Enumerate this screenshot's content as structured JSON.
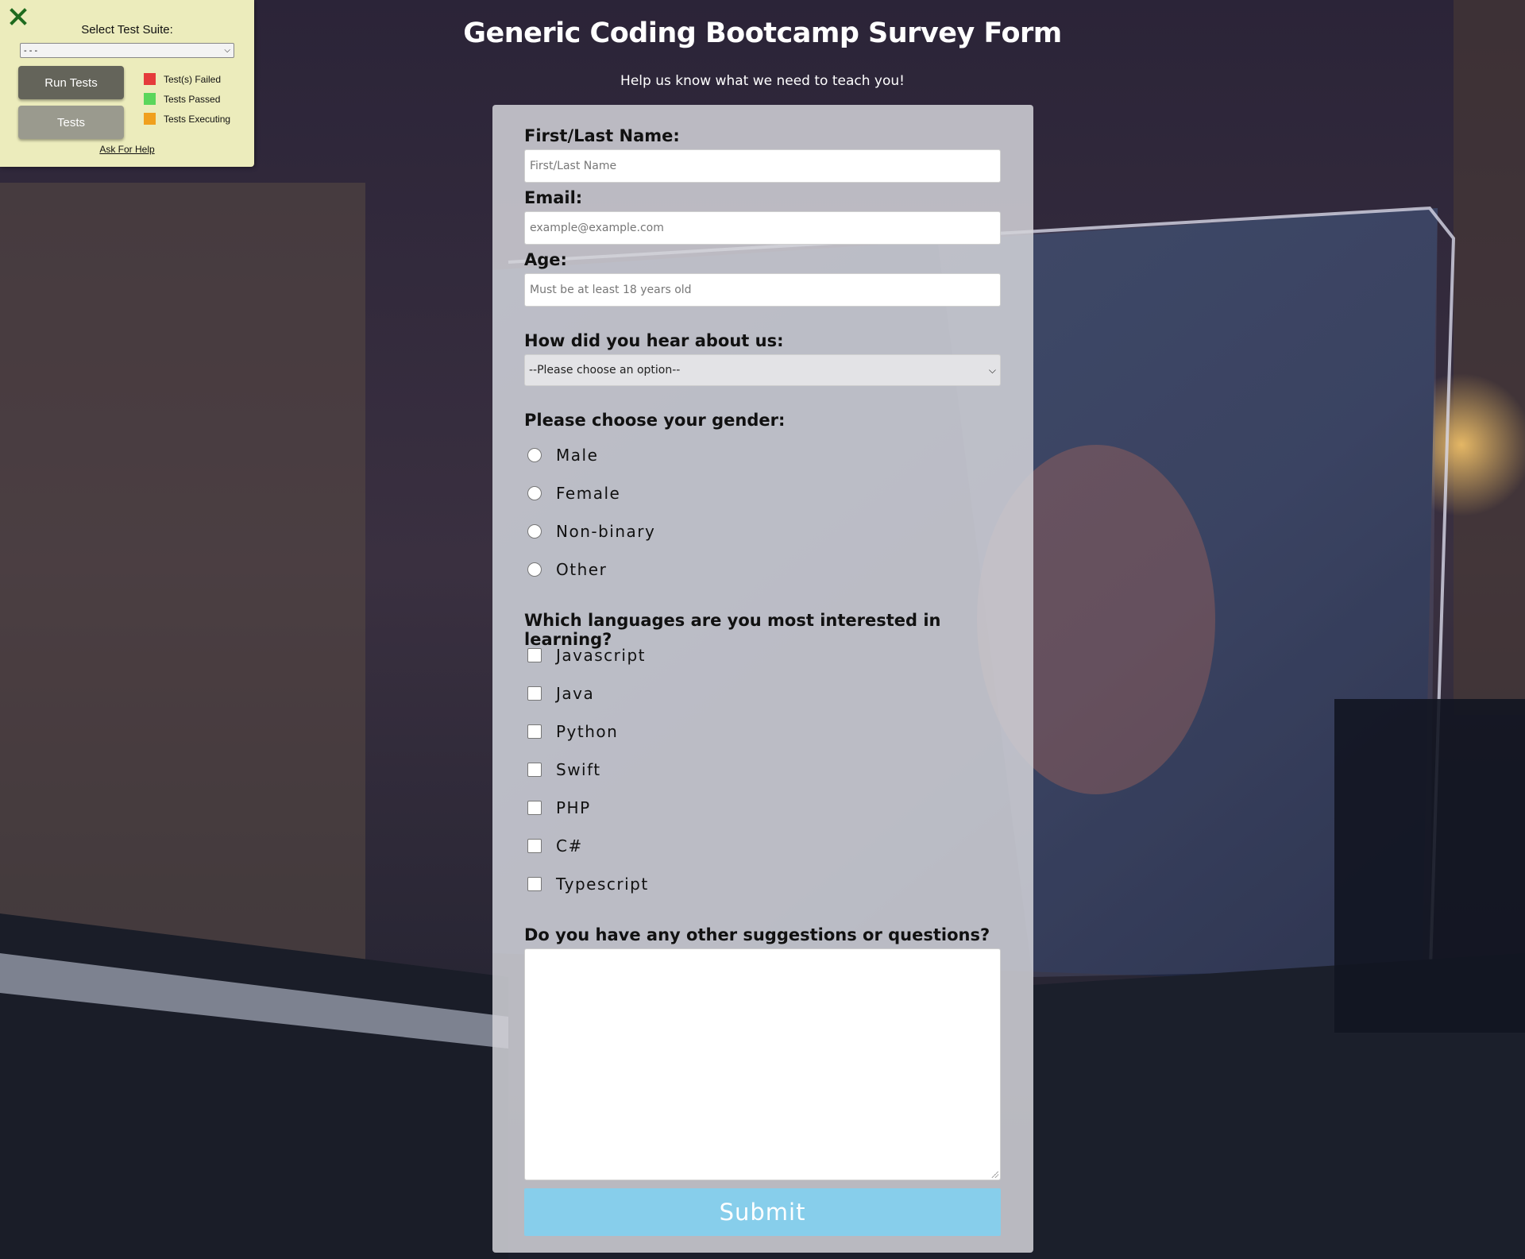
{
  "colors": {
    "submit_bg": "#87ceeb",
    "failed": "#e53b3b",
    "passed": "#5bd65b",
    "executing": "#f0a01e",
    "panel_bg": "#ececbc",
    "run_btn": "#64645a",
    "tests_btn": "#9a9a8e"
  },
  "test_panel": {
    "suite_label": "Select Test Suite:",
    "suite_value": "- - -",
    "run_button": "Run Tests",
    "tests_button": "Tests",
    "legend": [
      {
        "label": "Test(s) Failed",
        "color": "#e53b3b"
      },
      {
        "label": "Tests Passed",
        "color": "#5bd65b"
      },
      {
        "label": "Tests Executing",
        "color": "#f0a01e"
      }
    ],
    "help_link": "Ask For Help",
    "close_icon": "close-icon"
  },
  "header": {
    "title": "Generic Coding Bootcamp Survey Form",
    "subtitle": "Help us know what we need to teach you!"
  },
  "form": {
    "name_label": "First/Last Name:",
    "name_placeholder": "First/Last Name",
    "email_label": "Email:",
    "email_placeholder": "example@example.com",
    "age_label": "Age:",
    "age_placeholder": "Must be at least 18 years old",
    "hear_label": "How did you hear about us:",
    "hear_value": "--Please choose an option--",
    "gender_label": "Please choose your gender:",
    "gender_options": [
      "Male",
      "Female",
      "Non-binary",
      "Other"
    ],
    "languages_label": "Which languages are you most interested in learning?",
    "language_options": [
      "Javascript",
      "Java",
      "Python",
      "Swift",
      "PHP",
      "C#",
      "Typescript"
    ],
    "suggestions_label": "Do you have any other suggestions or questions?",
    "submit_label": "Submit"
  }
}
